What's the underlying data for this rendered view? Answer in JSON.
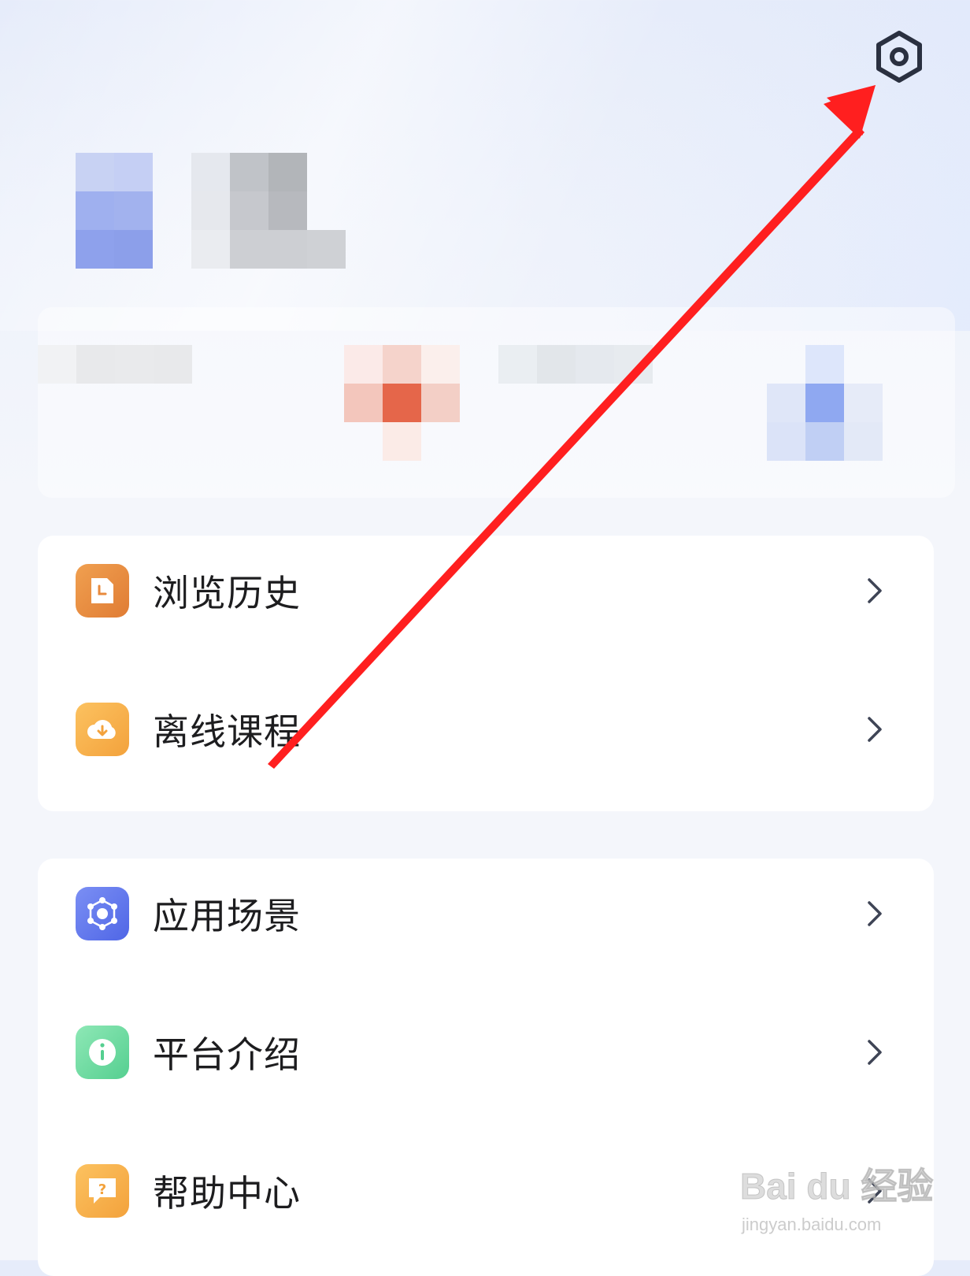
{
  "header": {
    "settings_icon": "gear-hexagon-icon"
  },
  "menu_group_1": [
    {
      "label": "浏览历史",
      "icon": "history-icon",
      "color": "#e88a3c"
    },
    {
      "label": "离线课程",
      "icon": "cloud-download-icon",
      "color": "#f6b04a"
    }
  ],
  "menu_group_2": [
    {
      "label": "应用场景",
      "icon": "network-icon",
      "color": "#5c72ec"
    },
    {
      "label": "平台介绍",
      "icon": "info-icon",
      "color": "#6bd9a0"
    },
    {
      "label": "帮助中心",
      "icon": "help-chat-icon",
      "color": "#f6b04a"
    }
  ],
  "annotation": {
    "type": "red-arrow",
    "color": "#ff1f1f"
  },
  "watermark": {
    "brand": "Bai du 经验",
    "url": "jingyan.baidu.com"
  }
}
